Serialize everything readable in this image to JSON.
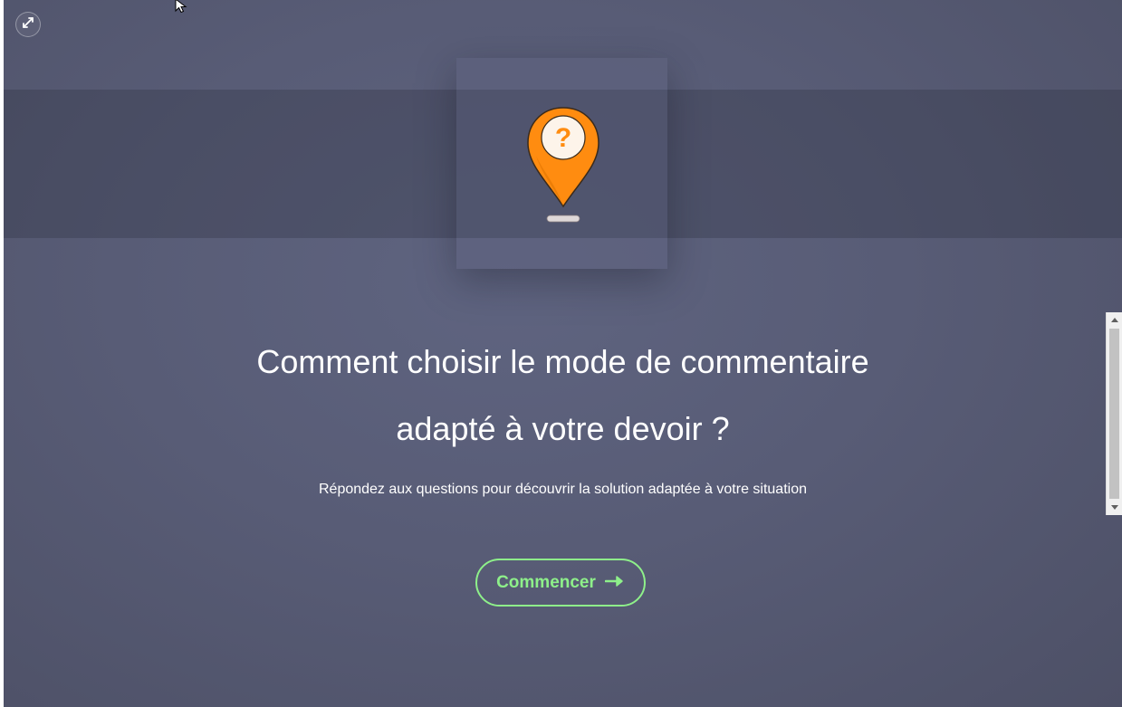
{
  "quiz": {
    "title_line1": "Comment choisir le mode de commentaire",
    "title_line2": "adapté à votre devoir ?",
    "subtitle": "Répondez aux questions pour découvrir la solution adaptée à votre situation",
    "start_label": "Commencer",
    "pin_symbol": "?"
  },
  "icons": {
    "expand": "expand-arrows-icon",
    "pin": "question-map-pin-icon",
    "arrow": "arrow-right-icon"
  },
  "colors": {
    "accent_green": "#8ef08a",
    "pin_orange": "#ff8c10",
    "background": "#585c76"
  }
}
